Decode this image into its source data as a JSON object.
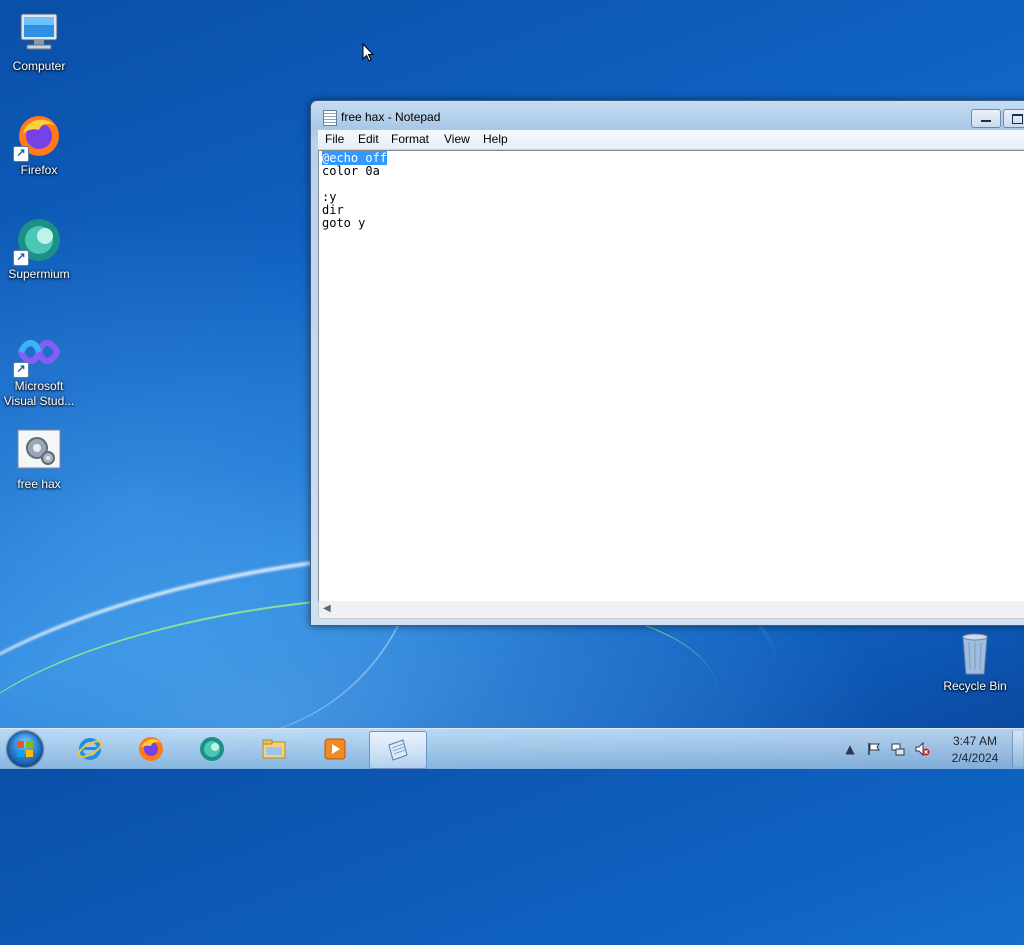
{
  "desktop": {
    "icons": [
      {
        "label_line1": "Computer",
        "label_line2": "",
        "icon": "computer-icon",
        "shortcut": false
      },
      {
        "label_line1": "Firefox",
        "label_line2": "",
        "icon": "firefox-icon",
        "shortcut": true
      },
      {
        "label_line1": "Supermium",
        "label_line2": "",
        "icon": "supermium-icon",
        "shortcut": true
      },
      {
        "label_line1": "Microsoft",
        "label_line2": "Visual Stud...",
        "icon": "visual-studio-icon",
        "shortcut": true
      },
      {
        "label_line1": "free hax",
        "label_line2": "",
        "icon": "batch-file-icon",
        "shortcut": false
      },
      {
        "label_line1": "Recycle Bin",
        "label_line2": "",
        "icon": "recycle-bin-icon",
        "shortcut": false
      }
    ]
  },
  "notepad": {
    "title": "free hax - Notepad",
    "menu": [
      "File",
      "Edit",
      "Format",
      "View",
      "Help"
    ],
    "content": {
      "selected_line": "@echo off",
      "lines": [
        "color 0a",
        "",
        ":y",
        "dir",
        "goto y"
      ]
    }
  },
  "taskbar": {
    "apps": [
      "internet-explorer-icon",
      "firefox-icon",
      "supermium-icon",
      "file-explorer-icon",
      "media-player-icon",
      "notepad-icon"
    ],
    "tray_icons": [
      "show-hidden-icons-icon",
      "action-center-flag-icon",
      "network-icon",
      "volume-muted-icon"
    ],
    "time": "3:47 AM",
    "date": "2/4/2024"
  }
}
